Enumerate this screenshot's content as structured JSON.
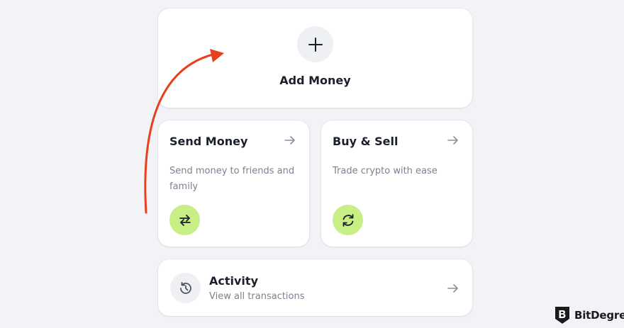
{
  "add_money": {
    "label": "Add Money",
    "icon": "plus-icon"
  },
  "send_money": {
    "title": "Send Money",
    "description": "Send money to friends and family",
    "icon": "swap-arrows-icon",
    "arrow_icon": "arrow-right-icon"
  },
  "buy_sell": {
    "title": "Buy & Sell",
    "description": "Trade crypto with ease",
    "icon": "refresh-icon",
    "arrow_icon": "arrow-right-icon"
  },
  "activity": {
    "title": "Activity",
    "subtitle": "View all transactions",
    "icon": "history-icon",
    "arrow_icon": "arrow-right-icon"
  },
  "watermark": {
    "text": "BitDegree"
  },
  "colors": {
    "background": "#f1f3f6",
    "card": "#ffffff",
    "accent_green": "#c8ee86",
    "annotation_arrow": "#e8401c",
    "muted_text": "#7b8190"
  }
}
